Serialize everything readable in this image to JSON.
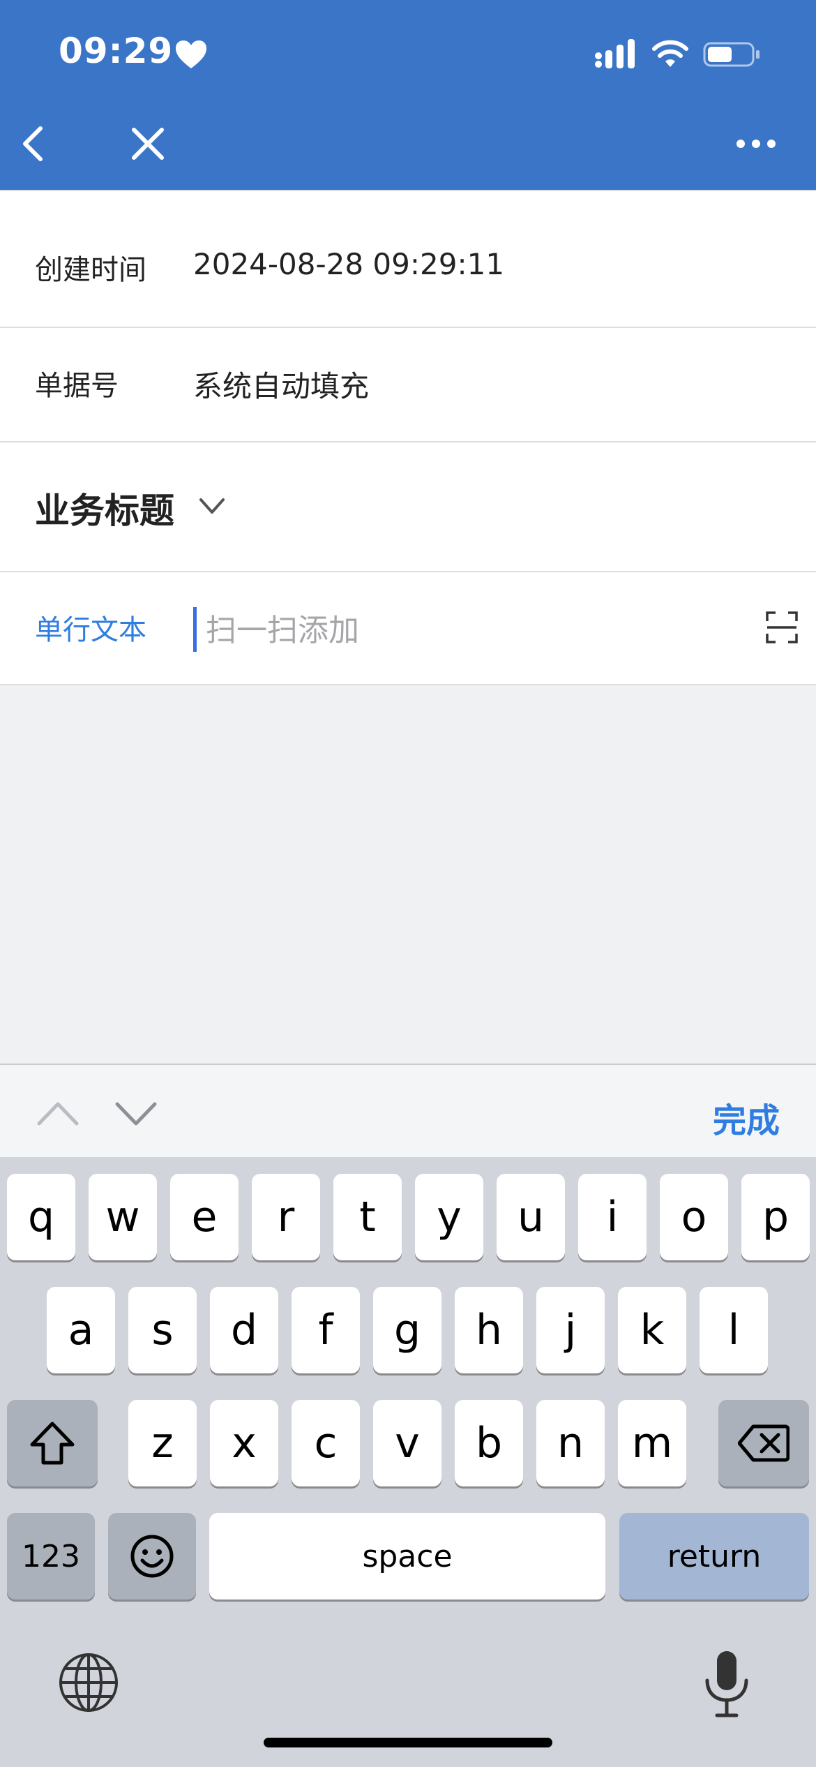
{
  "status_bar": {
    "time": "09:29"
  },
  "nav": {
    "back_icon": "chevron-left-icon",
    "close_icon": "close-icon",
    "more_icon": "more-icon"
  },
  "form": {
    "created_time": {
      "label": "创建时间",
      "value": "2024-08-28 09:29:11"
    },
    "doc_number": {
      "label": "单据号",
      "value": "系统自动填充"
    },
    "group": {
      "title": "业务标题"
    },
    "text_field": {
      "label": "单行文本",
      "placeholder": "扫一扫添加",
      "value": ""
    }
  },
  "toolbar": {
    "done_label": "完成"
  },
  "keyboard": {
    "row1": [
      "q",
      "w",
      "e",
      "r",
      "t",
      "y",
      "u",
      "i",
      "o",
      "p"
    ],
    "row2": [
      "a",
      "s",
      "d",
      "f",
      "g",
      "h",
      "j",
      "k",
      "l"
    ],
    "row3": [
      "z",
      "x",
      "c",
      "v",
      "b",
      "n",
      "m"
    ],
    "numbers_label": "123",
    "space_label": "space",
    "return_label": "return"
  },
  "colors": {
    "nav_blue": "#3a75c8",
    "accent": "#2f7de1"
  }
}
